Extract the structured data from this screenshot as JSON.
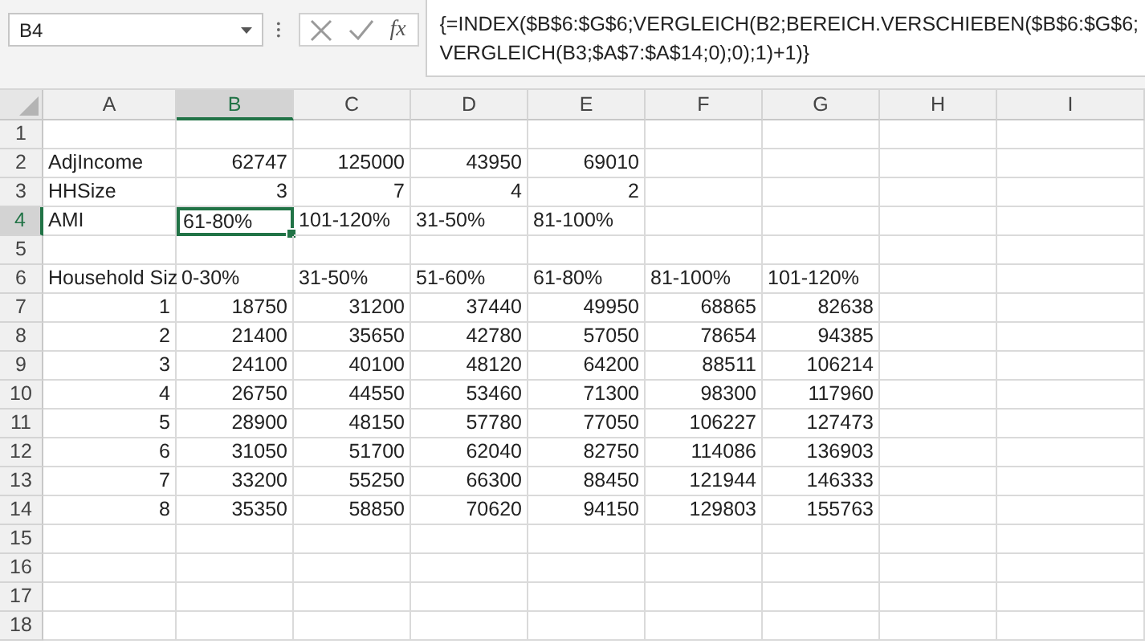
{
  "name_box": {
    "value": "B4"
  },
  "formula_bar": {
    "fx": "fx",
    "formula": "{=INDEX($B$6:$G$6;VERGLEICH(B2;BEREICH.VERSCHIEBEN($B$6:$G$6;\nVERGLEICH(B3;$A$7:$A$14;0);0);1)+1)}"
  },
  "columns": [
    {
      "label": "A",
      "selected": false
    },
    {
      "label": "B",
      "selected": true
    },
    {
      "label": "C",
      "selected": false
    },
    {
      "label": "D",
      "selected": false
    },
    {
      "label": "E",
      "selected": false
    },
    {
      "label": "F",
      "selected": false
    },
    {
      "label": "G",
      "selected": false
    },
    {
      "label": "H",
      "selected": false
    },
    {
      "label": "I",
      "selected": false
    }
  ],
  "rows": [
    {
      "label": "1",
      "selected": false,
      "cells": []
    },
    {
      "label": "2",
      "selected": false,
      "cells": [
        {
          "text": "AdjIncome",
          "kind": "text"
        },
        {
          "text": "62747",
          "kind": "number"
        },
        {
          "text": "125000",
          "kind": "number"
        },
        {
          "text": "43950",
          "kind": "number"
        },
        {
          "text": "69010",
          "kind": "number"
        }
      ]
    },
    {
      "label": "3",
      "selected": false,
      "cells": [
        {
          "text": "HHSize",
          "kind": "text"
        },
        {
          "text": "3",
          "kind": "number"
        },
        {
          "text": "7",
          "kind": "number"
        },
        {
          "text": "4",
          "kind": "number"
        },
        {
          "text": "2",
          "kind": "number"
        }
      ]
    },
    {
      "label": "4",
      "selected": true,
      "cells": [
        {
          "text": "AMI",
          "kind": "text"
        },
        {
          "text": "61-80%",
          "kind": "text"
        },
        {
          "text": "101-120%",
          "kind": "text"
        },
        {
          "text": "31-50%",
          "kind": "text"
        },
        {
          "text": "81-100%",
          "kind": "text"
        }
      ]
    },
    {
      "label": "5",
      "selected": false,
      "cells": []
    },
    {
      "label": "6",
      "selected": false,
      "cells": [
        {
          "text": "Household Siz",
          "kind": "text"
        },
        {
          "text": "0-30%",
          "kind": "text"
        },
        {
          "text": "31-50%",
          "kind": "text"
        },
        {
          "text": "51-60%",
          "kind": "text"
        },
        {
          "text": "61-80%",
          "kind": "text"
        },
        {
          "text": "81-100%",
          "kind": "text"
        },
        {
          "text": "101-120%",
          "kind": "text"
        }
      ]
    },
    {
      "label": "7",
      "selected": false,
      "cells": [
        {
          "text": "1",
          "kind": "number"
        },
        {
          "text": "18750",
          "kind": "number"
        },
        {
          "text": "31200",
          "kind": "number"
        },
        {
          "text": "37440",
          "kind": "number"
        },
        {
          "text": "49950",
          "kind": "number"
        },
        {
          "text": "68865",
          "kind": "number"
        },
        {
          "text": "82638",
          "kind": "number"
        }
      ]
    },
    {
      "label": "8",
      "selected": false,
      "cells": [
        {
          "text": "2",
          "kind": "number"
        },
        {
          "text": "21400",
          "kind": "number"
        },
        {
          "text": "35650",
          "kind": "number"
        },
        {
          "text": "42780",
          "kind": "number"
        },
        {
          "text": "57050",
          "kind": "number"
        },
        {
          "text": "78654",
          "kind": "number"
        },
        {
          "text": "94385",
          "kind": "number"
        }
      ]
    },
    {
      "label": "9",
      "selected": false,
      "cells": [
        {
          "text": "3",
          "kind": "number"
        },
        {
          "text": "24100",
          "kind": "number"
        },
        {
          "text": "40100",
          "kind": "number"
        },
        {
          "text": "48120",
          "kind": "number"
        },
        {
          "text": "64200",
          "kind": "number"
        },
        {
          "text": "88511",
          "kind": "number"
        },
        {
          "text": "106214",
          "kind": "number"
        }
      ]
    },
    {
      "label": "10",
      "selected": false,
      "cells": [
        {
          "text": "4",
          "kind": "number"
        },
        {
          "text": "26750",
          "kind": "number"
        },
        {
          "text": "44550",
          "kind": "number"
        },
        {
          "text": "53460",
          "kind": "number"
        },
        {
          "text": "71300",
          "kind": "number"
        },
        {
          "text": "98300",
          "kind": "number"
        },
        {
          "text": "117960",
          "kind": "number"
        }
      ]
    },
    {
      "label": "11",
      "selected": false,
      "cells": [
        {
          "text": "5",
          "kind": "number"
        },
        {
          "text": "28900",
          "kind": "number"
        },
        {
          "text": "48150",
          "kind": "number"
        },
        {
          "text": "57780",
          "kind": "number"
        },
        {
          "text": "77050",
          "kind": "number"
        },
        {
          "text": "106227",
          "kind": "number"
        },
        {
          "text": "127473",
          "kind": "number"
        }
      ]
    },
    {
      "label": "12",
      "selected": false,
      "cells": [
        {
          "text": "6",
          "kind": "number"
        },
        {
          "text": "31050",
          "kind": "number"
        },
        {
          "text": "51700",
          "kind": "number"
        },
        {
          "text": "62040",
          "kind": "number"
        },
        {
          "text": "82750",
          "kind": "number"
        },
        {
          "text": "114086",
          "kind": "number"
        },
        {
          "text": "136903",
          "kind": "number"
        }
      ]
    },
    {
      "label": "13",
      "selected": false,
      "cells": [
        {
          "text": "7",
          "kind": "number"
        },
        {
          "text": "33200",
          "kind": "number"
        },
        {
          "text": "55250",
          "kind": "number"
        },
        {
          "text": "66300",
          "kind": "number"
        },
        {
          "text": "88450",
          "kind": "number"
        },
        {
          "text": "121944",
          "kind": "number"
        },
        {
          "text": "146333",
          "kind": "number"
        }
      ]
    },
    {
      "label": "14",
      "selected": false,
      "cells": [
        {
          "text": "8",
          "kind": "number"
        },
        {
          "text": "35350",
          "kind": "number"
        },
        {
          "text": "58850",
          "kind": "number"
        },
        {
          "text": "70620",
          "kind": "number"
        },
        {
          "text": "94150",
          "kind": "number"
        },
        {
          "text": "129803",
          "kind": "number"
        },
        {
          "text": "155763",
          "kind": "number"
        }
      ]
    },
    {
      "label": "15",
      "selected": false,
      "cells": []
    },
    {
      "label": "16",
      "selected": false,
      "cells": []
    },
    {
      "label": "17",
      "selected": false,
      "cells": []
    },
    {
      "label": "18",
      "selected": false,
      "cells": []
    }
  ]
}
